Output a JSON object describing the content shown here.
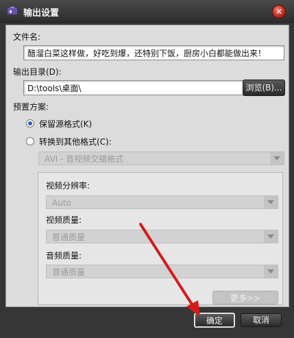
{
  "window": {
    "title": "输出设置"
  },
  "file_name": {
    "label": "文件名:",
    "value": "醋溜白菜这样做，好吃到爆，还特别下饭，厨房小白都能做出来！"
  },
  "output_dir": {
    "label": "输出目录(D):",
    "value": "D:\\tools\\桌面\\",
    "browse_label": "浏览(B)..."
  },
  "preset": {
    "label": "预置方案:",
    "keep_source": "保留源格式(K)",
    "convert": "转换到其他格式(C):",
    "format_value": "AVI - 音视频交错格式",
    "keep_source_selected": true
  },
  "video": {
    "resolution_label": "视频分辨率:",
    "resolution_value": "Auto",
    "quality_label": "视频质量:",
    "quality_value": "普通质量"
  },
  "audio": {
    "quality_label": "音频质量:",
    "quality_value": "普通质量"
  },
  "buttons": {
    "more": "更多>>",
    "ok": "确定",
    "cancel": "取消"
  },
  "colors": {
    "annotation_arrow": "#d21b1b",
    "radio_dot": "#2a5fb8"
  }
}
